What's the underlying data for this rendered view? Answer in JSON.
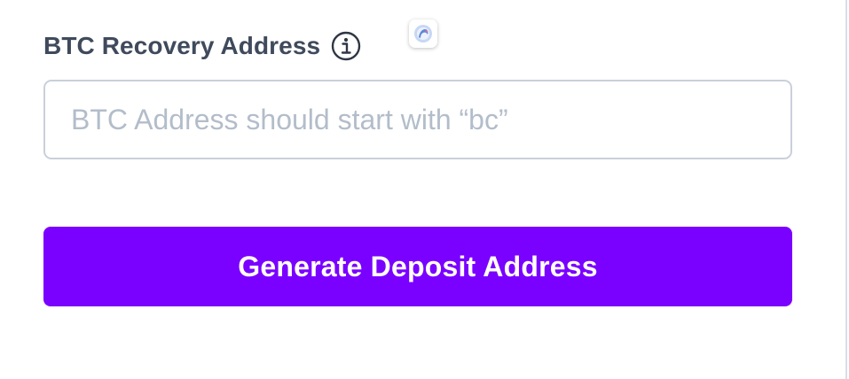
{
  "recovery_field": {
    "label": "BTC Recovery Address",
    "info_icon": "info-icon",
    "input_value": "",
    "input_placeholder": "BTC Address should start with “bc”"
  },
  "floating_badge_icon": "extension-badge-icon",
  "actions": {
    "generate_label": "Generate Deposit Address"
  },
  "colors": {
    "label": "#3f4a5c",
    "placeholder": "#b3bdca",
    "input_border": "#c9d0db",
    "button_bg": "#7a00ff",
    "button_text": "#ffffff"
  }
}
